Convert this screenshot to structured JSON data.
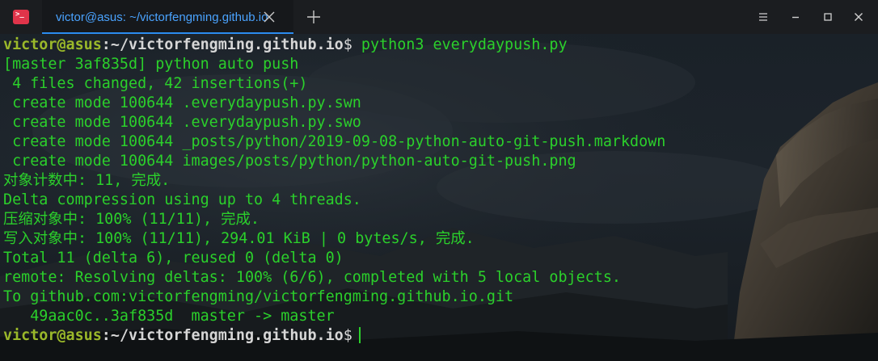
{
  "window": {
    "tab_title": "victor@asus: ~/victorfengming.github.io",
    "app_icon_glyph": ">_"
  },
  "icons": {
    "app": "terminal-app-icon",
    "tab_close": "close-icon",
    "new_tab": "plus-icon",
    "menu": "hamburger-menu-icon",
    "minimize": "minimize-icon",
    "maximize": "maximize-icon",
    "close": "close-icon"
  },
  "colors": {
    "prompt_user": "#9ab82a",
    "prompt_path": "#d6d6d6",
    "output_text": "#2bd02b",
    "tab_text": "#4aa3ff",
    "app_icon": "#e0344a"
  },
  "terminal": {
    "prompt": {
      "user_host": "victor@asus",
      "separator": ":",
      "path": "~/victorfengming.github.io",
      "sign": "$"
    },
    "command": " python3 everydaypush.py",
    "output": [
      "[master 3af835d] python auto push",
      " 4 files changed, 42 insertions(+)",
      " create mode 100644 .everydaypush.py.swn",
      " create mode 100644 .everydaypush.py.swo",
      " create mode 100644 _posts/python/2019-09-08-python-auto-git-push.markdown",
      " create mode 100644 images/posts/python/python-auto-git-push.png",
      "对象计数中: 11, 完成.",
      "Delta compression using up to 4 threads.",
      "压缩对象中: 100% (11/11), 完成.",
      "写入对象中: 100% (11/11), 294.01 KiB | 0 bytes/s, 完成.",
      "Total 11 (delta 6), reused 0 (delta 0)",
      "remote: Resolving deltas: 100% (6/6), completed with 5 local objects.",
      "To github.com:victorfengming/victorfengming.github.io.git",
      "   49aac0c..3af835d  master -> master"
    ]
  }
}
